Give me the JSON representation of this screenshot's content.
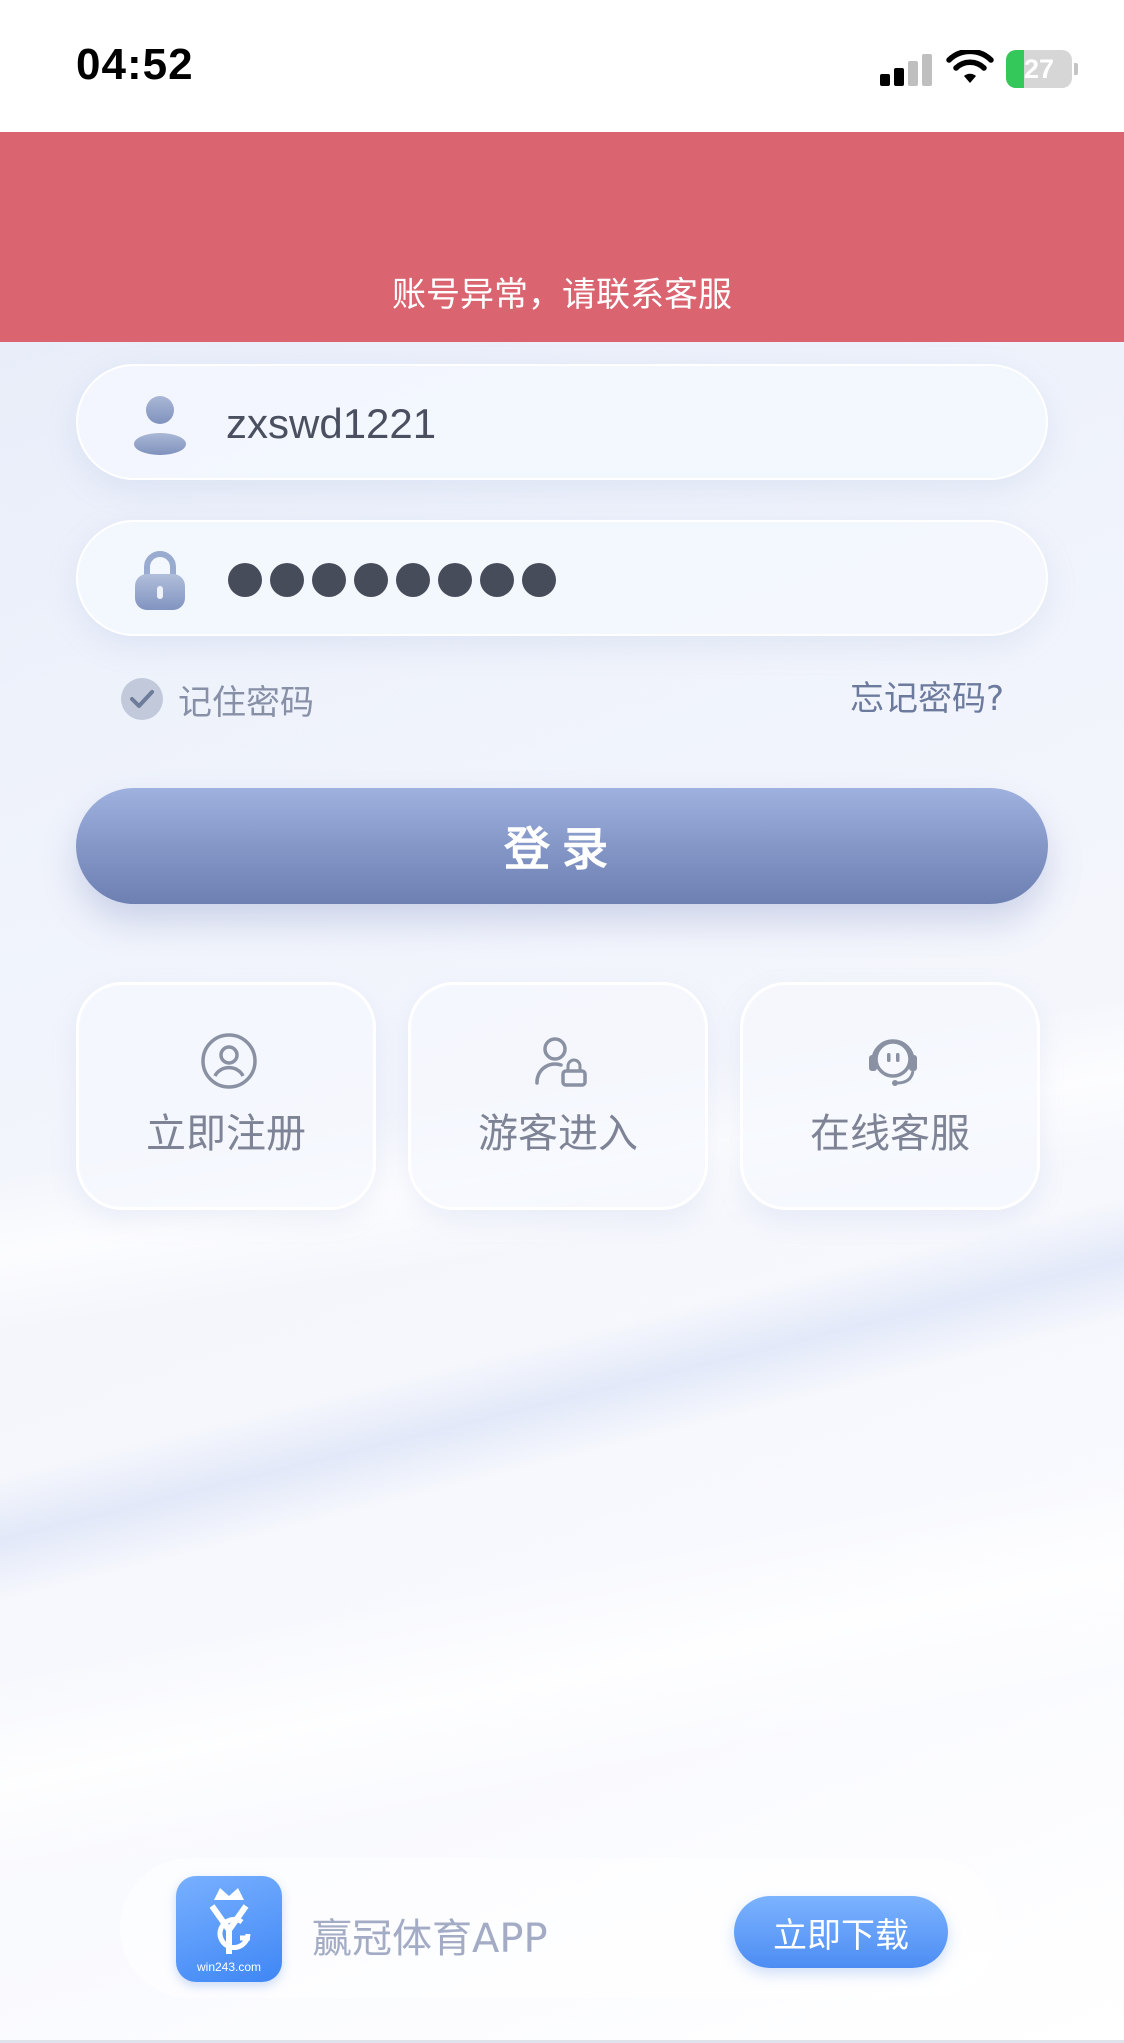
{
  "status_bar": {
    "time": "04:52",
    "battery_percent": "27",
    "battery_level": 0.27,
    "signal_bars": 2,
    "icons": [
      "signal-icon",
      "wifi-icon",
      "battery-charging-icon"
    ]
  },
  "alert": {
    "message": "账号异常，请联系客服",
    "color": "#da6470"
  },
  "login_form": {
    "username": {
      "value": "zxswd1221",
      "icon": "user-icon"
    },
    "password": {
      "masked_length": 8,
      "icon": "lock-icon"
    },
    "remember_label": "记住密码",
    "remember_checked": true,
    "forgot_label": "忘记密码?",
    "submit_label": "登录"
  },
  "quick_actions": [
    {
      "label": "立即注册",
      "icon": "user-circle-icon"
    },
    {
      "label": "游客进入",
      "icon": "guest-icon"
    },
    {
      "label": "在线客服",
      "icon": "headset-icon"
    }
  ],
  "download_banner": {
    "app_name": "赢冠体育APP",
    "logo_caption": "win243.com",
    "button_label": "立即下载",
    "accent_color": "#4d8df3"
  }
}
